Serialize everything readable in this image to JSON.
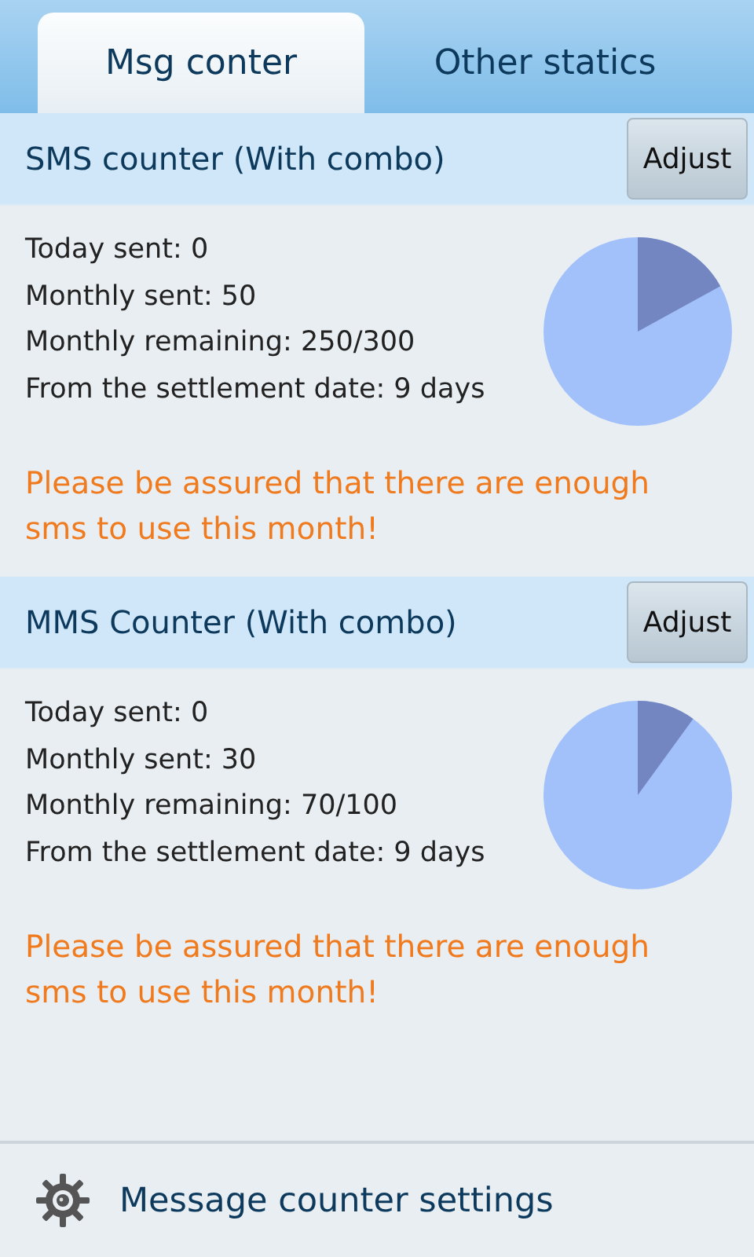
{
  "tabs": [
    {
      "label": "Msg conter",
      "selected": true
    },
    {
      "label": "Other statics",
      "selected": false
    }
  ],
  "sections": [
    {
      "title": "SMS counter (With combo)",
      "button": "Adjust",
      "stats": [
        "Today sent: 0",
        "Monthly sent: 50",
        "Monthly remaining: 250/300",
        "From the settlement date: 9 days"
      ],
      "notice": "Please be assured that there are enough sms to use this month!"
    },
    {
      "title": "MMS Counter (With combo)",
      "button": "Adjust",
      "stats": [
        "Today sent: 0",
        "Monthly sent: 30",
        "Monthly remaining: 70/100",
        "From the settlement date: 9 days"
      ],
      "notice": "Please be assured that there are enough sms to use this month!"
    }
  ],
  "footer": {
    "label": "Message counter settings"
  }
}
